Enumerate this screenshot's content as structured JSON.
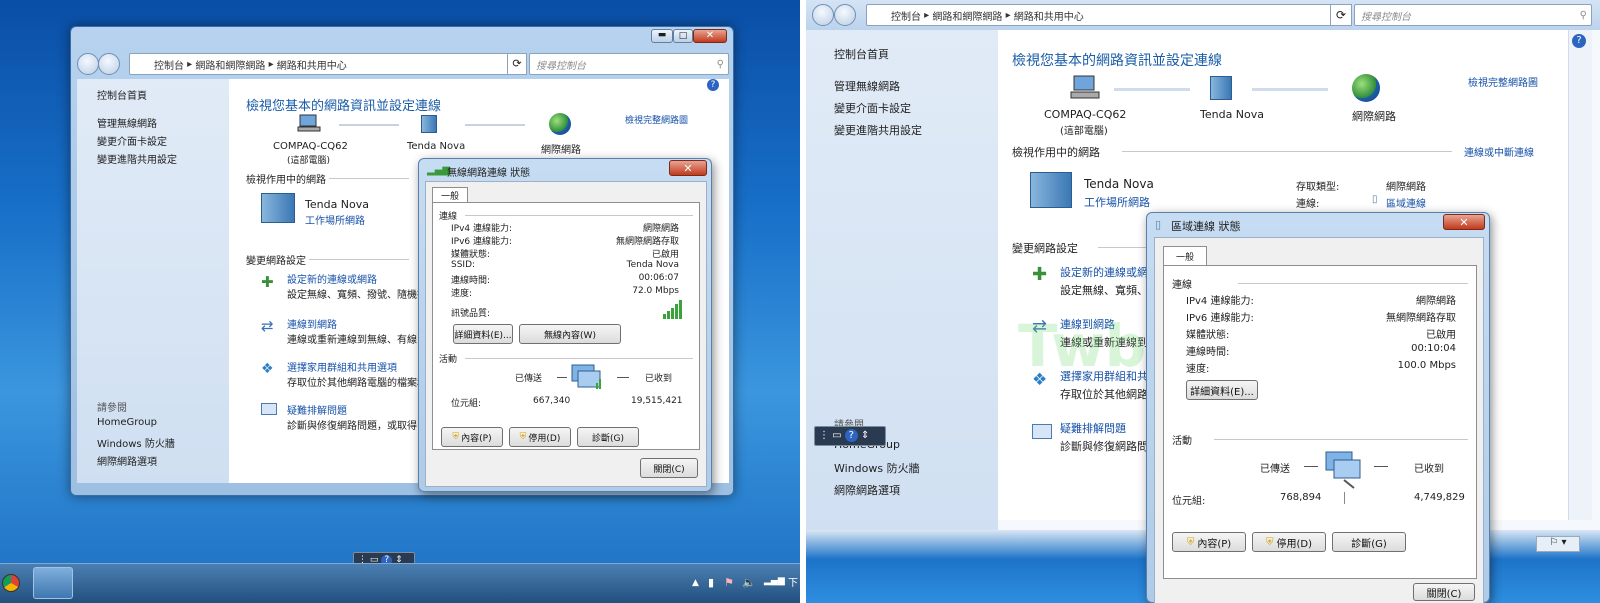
{
  "left": {
    "breadcrumb": [
      "控制台",
      "網路和網際網路",
      "網路和共用中心"
    ],
    "search_placeholder": "搜尋控制台",
    "sidebar": {
      "home": "控制台首頁",
      "items": [
        "管理無線網路",
        "變更介面卡設定",
        "變更進階共用設定"
      ],
      "see_also_title": "請參閱",
      "see_also": [
        "HomeGroup",
        "Windows 防火牆",
        "網際網路選項"
      ]
    },
    "main": {
      "title": "檢視您基本的網路資訊並設定連線",
      "view_full_map": "檢視完整網路圖",
      "nodes": [
        "COMPAQ-CQ62",
        "(這部電腦)",
        "Tenda Nova",
        "網際網路"
      ],
      "active_networks": "檢視作用中的網路",
      "network_name": "Tenda Nova",
      "network_type": "工作場所網路",
      "change_settings": "變更網路設定",
      "tasks": [
        {
          "title": "設定新的連線或網路",
          "desc": "設定無線、寬頻、撥號、隨機操"
        },
        {
          "title": "連線到網路",
          "desc": "連線或重新連線到無線、有線"
        },
        {
          "title": "選擇家用群組和共用選項",
          "desc": "存取位於其他網路電腦的檔案和"
        },
        {
          "title": "疑難排解問題",
          "desc": "診斷與修復網路問題，或取得"
        }
      ]
    },
    "dialog": {
      "title": "無線網路連線 狀態",
      "tab": "一般",
      "connection_section": "連線",
      "fields": [
        {
          "label": "IPv4 連線能力:",
          "value": "網際網路"
        },
        {
          "label": "IPv6 連線能力:",
          "value": "無網際網路存取"
        },
        {
          "label": "媒體狀態:",
          "value": "已啟用"
        },
        {
          "label": "SSID:",
          "value": "Tenda Nova"
        },
        {
          "label": "連線時間:",
          "value": "00:06:07"
        },
        {
          "label": "速度:",
          "value": "72.0 Mbps"
        }
      ],
      "signal_label": "訊號品質:",
      "details_btn": "詳細資料(E)...",
      "wireless_props_btn": "無線內容(W)",
      "activity_section": "活動",
      "sent_label": "已傳送",
      "received_label": "已收到",
      "bytes_label": "位元組:",
      "bytes_sent": "667,340",
      "bytes_received": "19,515,421",
      "props_btn": "內容(P)",
      "disable_btn": "停用(D)",
      "diagnose_btn": "診斷(G)",
      "close_btn": "關閉(C)"
    },
    "tray_time": "下"
  },
  "right": {
    "breadcrumb": [
      "控制台",
      "網路和網際網路",
      "網路和共用中心"
    ],
    "search_placeholder": "搜尋控制台",
    "sidebar": {
      "home": "控制台首頁",
      "items": [
        "管理無線網路",
        "變更介面卡設定",
        "變更進階共用設定"
      ],
      "see_also_title": "請參閱",
      "see_also": [
        "HomeGroup",
        "Windows 防火牆",
        "網際網路選項"
      ]
    },
    "main": {
      "title": "檢視您基本的網路資訊並設定連線",
      "view_full_map": "檢視完整網路圖",
      "nodes": [
        "COMPAQ-CQ62",
        "(這部電腦)",
        "Tenda Nova",
        "網際網路"
      ],
      "active_networks": "檢視作用中的網路",
      "connect_disconnect": "連線或中斷連線",
      "network_name": "Tenda Nova",
      "network_type": "工作場所網路",
      "access_type_label": "存取類型:",
      "access_type_value": "網際網路",
      "connection_label": "連線:",
      "connection_value": "區域連線",
      "change_settings": "變更網路設定",
      "tasks": [
        {
          "title": "設定新的連線或網路",
          "desc": "設定無線、寬頻、撥"
        },
        {
          "title": "連線到網路",
          "desc": "連線或重新連線到無線"
        },
        {
          "title": "選擇家用群組和共用",
          "desc": "存取位於其他網路"
        },
        {
          "title": "疑難排解問題",
          "desc": "診斷與修復網路問題"
        }
      ]
    },
    "dialog": {
      "title": "區域連線 狀態",
      "tab": "一般",
      "connection_section": "連線",
      "fields": [
        {
          "label": "IPv4 連線能力:",
          "value": "網際網路"
        },
        {
          "label": "IPv6 連線能力:",
          "value": "無網際網路存取"
        },
        {
          "label": "媒體狀態:",
          "value": "已啟用"
        },
        {
          "label": "連線時間:",
          "value": "00:10:04"
        },
        {
          "label": "速度:",
          "value": "100.0 Mbps"
        }
      ],
      "details_btn": "詳細資料(E)...",
      "activity_section": "活動",
      "sent_label": "已傳送",
      "received_label": "已收到",
      "bytes_label": "位元組:",
      "bytes_sent": "768,894",
      "bytes_received": "4,749,829",
      "props_btn": "內容(P)",
      "disable_btn": "停用(D)",
      "diagnose_btn": "診斷(G)",
      "close_btn": "關閉(C)"
    },
    "watermark": "Twbear.cc"
  }
}
